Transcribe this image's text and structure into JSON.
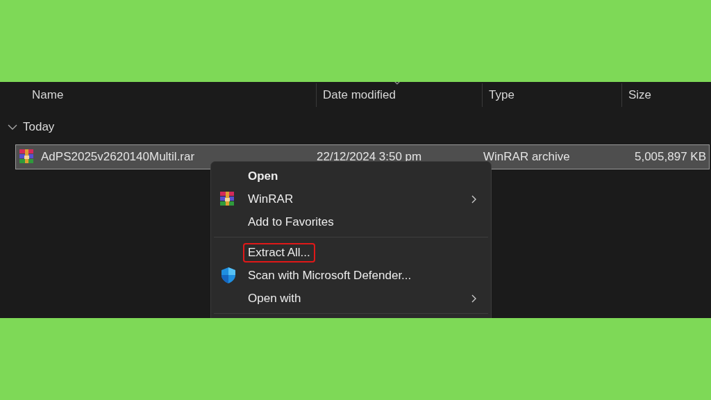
{
  "columns": [
    {
      "label": "Name",
      "sorted": false
    },
    {
      "label": "Date modified",
      "sorted": true
    },
    {
      "label": "Type",
      "sorted": false
    },
    {
      "label": "Size",
      "sorted": false
    }
  ],
  "groups": [
    {
      "label": "Today",
      "expanded": true,
      "files": [
        {
          "name": "AdPS2025v2620140Multil.rar",
          "date": "22/12/2024 3:50 pm",
          "type": "WinRAR archive",
          "size": "5,005,897 KB",
          "selected": true
        }
      ]
    }
  ],
  "context_menu": {
    "items": [
      {
        "kind": "item",
        "label": "Open",
        "default": true,
        "submenu": false,
        "highlighted": false
      },
      {
        "kind": "archive_item",
        "label": "WinRAR",
        "default": false,
        "submenu": true,
        "highlighted": false
      },
      {
        "kind": "item",
        "label": "Add to Favorites",
        "default": false,
        "submenu": false,
        "highlighted": false
      },
      {
        "kind": "separator"
      },
      {
        "kind": "item",
        "label": "Extract All...",
        "default": false,
        "submenu": false,
        "highlighted": true
      },
      {
        "kind": "shield_item",
        "label": "Scan with Microsoft Defender...",
        "default": false,
        "submenu": false,
        "highlighted": false
      },
      {
        "kind": "item",
        "label": "Open with",
        "default": false,
        "submenu": true,
        "highlighted": false
      },
      {
        "kind": "separator"
      }
    ]
  }
}
